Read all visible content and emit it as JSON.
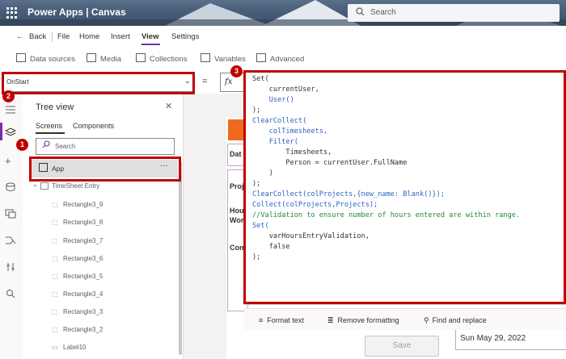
{
  "header": {
    "app_title": "Power Apps  |  Canvas",
    "search_placeholder": "Search"
  },
  "menu": {
    "back": "Back",
    "file": "File",
    "home": "Home",
    "insert": "Insert",
    "view": "View",
    "settings": "Settings"
  },
  "toolbar": {
    "data_sources": "Data sources",
    "media": "Media",
    "collections": "Collections",
    "variables": "Variables",
    "advanced": "Advanced"
  },
  "formula_bar": {
    "property": "OnStart",
    "equals": "=",
    "fx": "fx"
  },
  "tree_view": {
    "title": "Tree view",
    "tabs": [
      "Screens",
      "Components"
    ],
    "search_placeholder": "Search",
    "app_item": "App",
    "items": [
      "TimeSheet Entry",
      "Rectangle3_9",
      "Rectangle3_8",
      "Rectangle3_7",
      "Rectangle3_6",
      "Rectangle3_5",
      "Rectangle3_4",
      "Rectangle3_3",
      "Rectangle3_2",
      "Label10"
    ]
  },
  "canvas": {
    "labels": [
      "Dat",
      "Proj",
      "Hour",
      "Wor",
      "Com"
    ],
    "date_value": "Sun May 29, 2022",
    "save_label": "Save"
  },
  "editor": {
    "lines": [
      "Set(",
      "    currentUser,",
      "    User()",
      ");",
      "ClearCollect(",
      "    colTimesheets,",
      "    Filter(",
      "        Timesheets,",
      "        Person = currentUser.FullName",
      "    )",
      ");",
      "ClearCollect(colProjects,{new_name: Blank()});",
      "Collect(colProjects,Projects);",
      "//Validation to ensure number of hours entered are within range.",
      "Set(",
      "    varHoursEntryValidation,",
      "    false",
      ");"
    ],
    "format_text": "Format text",
    "remove_formatting": "Remove formatting",
    "find_replace": "Find and replace"
  },
  "annotations": {
    "badges": [
      "1",
      "2",
      "3"
    ],
    "color": "#c00000"
  },
  "colors": {
    "accent": "#7a2bb0",
    "canvas_orange": "#f06a1d"
  },
  "icons": [
    "waffle-icon",
    "search-icon",
    "back-arrow-icon",
    "close-icon",
    "more-icon"
  ]
}
